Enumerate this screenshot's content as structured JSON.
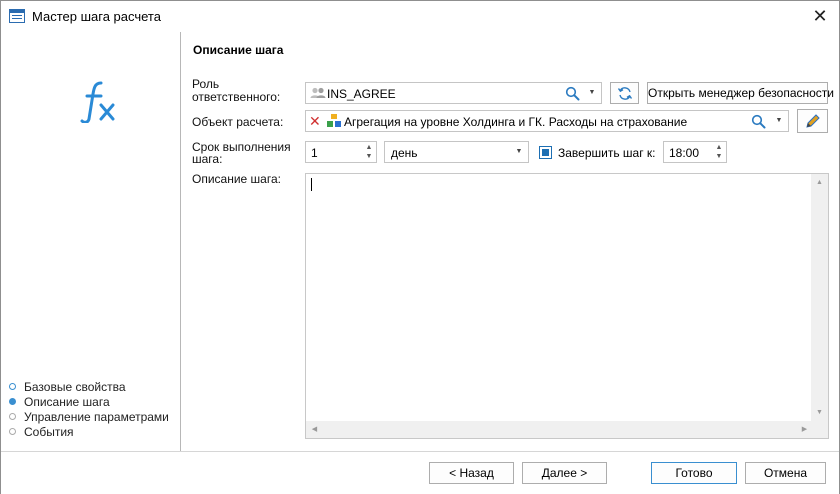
{
  "window": {
    "title": "Мастер шага расчета"
  },
  "sidebar": {
    "steps": [
      {
        "label": "Базовые свойства"
      },
      {
        "label": "Описание шага"
      },
      {
        "label": "Управление параметрами"
      },
      {
        "label": "События"
      }
    ]
  },
  "main": {
    "section_title": "Описание шага",
    "role": {
      "label_line1": "Роль",
      "label_line2": "ответственного:",
      "value": "INS_AGREE",
      "security_button": "Открыть менеджер безопасности"
    },
    "object": {
      "label": "Объект расчета:",
      "value": "Агрегация на уровне Холдинга и ГК. Расходы на страхование"
    },
    "deadline": {
      "label_line1": "Срок выполнения",
      "label_line2": "шага:",
      "amount": "1",
      "unit": "день",
      "finish_label": "Завершить шаг к:",
      "finish_time": "18:00"
    },
    "description": {
      "label": "Описание шага:",
      "value": ""
    }
  },
  "footer": {
    "back": "< Назад",
    "next": "Далее >",
    "done": "Готово",
    "cancel": "Отмена"
  },
  "colors": {
    "accent": "#3a8fd0",
    "checkbox": "#1d6fb3",
    "fx_logo": "#2a8ad6"
  }
}
